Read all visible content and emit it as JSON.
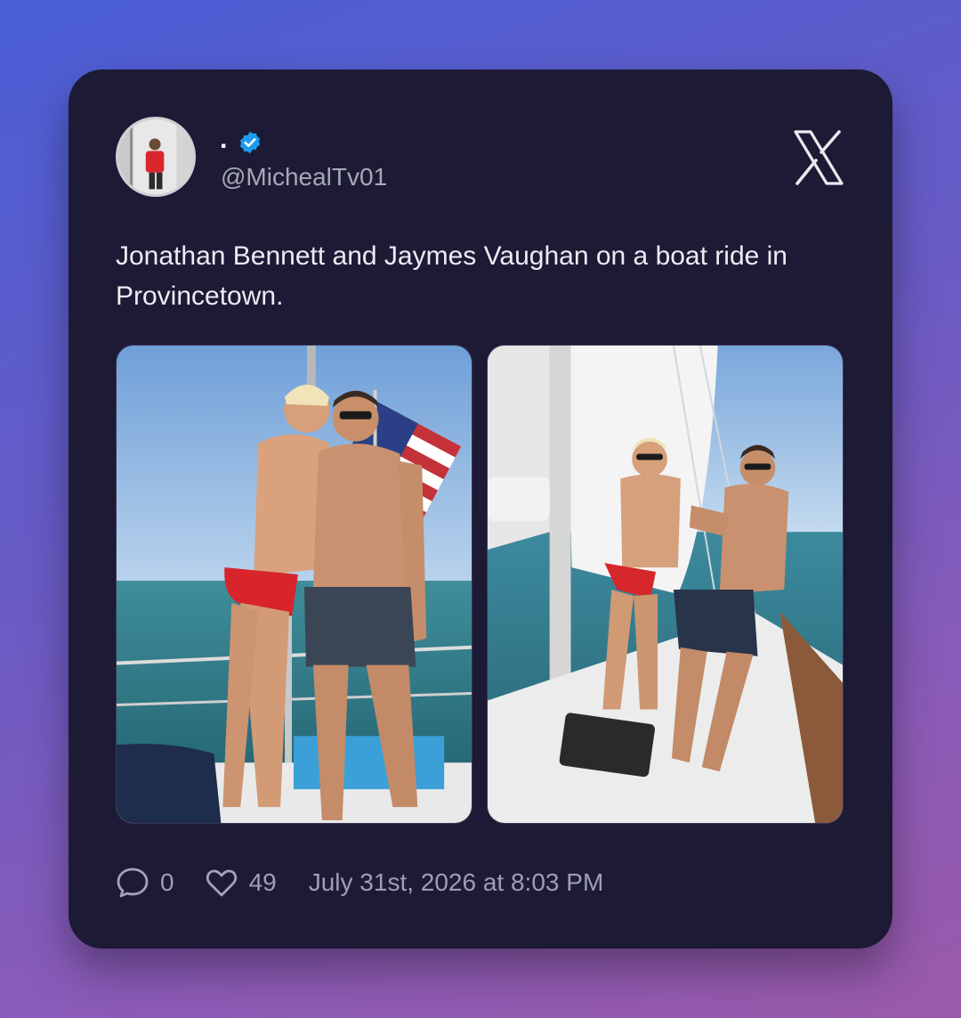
{
  "post": {
    "display_name": ".",
    "handle": "@MichealTv01",
    "verified": true,
    "text": "Jonathan Bennett and Jaymes Vaughan on a boat ride in Provincetown.",
    "platform_icon": "x-logo-icon",
    "replies": "0",
    "likes": "49",
    "timestamp": "July 31st, 2026 at 8:03 PM"
  },
  "icons": {
    "reply": "speech-bubble-icon",
    "like": "heart-icon",
    "verified": "verified-badge-icon"
  },
  "colors": {
    "card_background": "#1d1a35",
    "verified_blue": "#1d9bf0",
    "muted_text": "#9e9eb3"
  }
}
